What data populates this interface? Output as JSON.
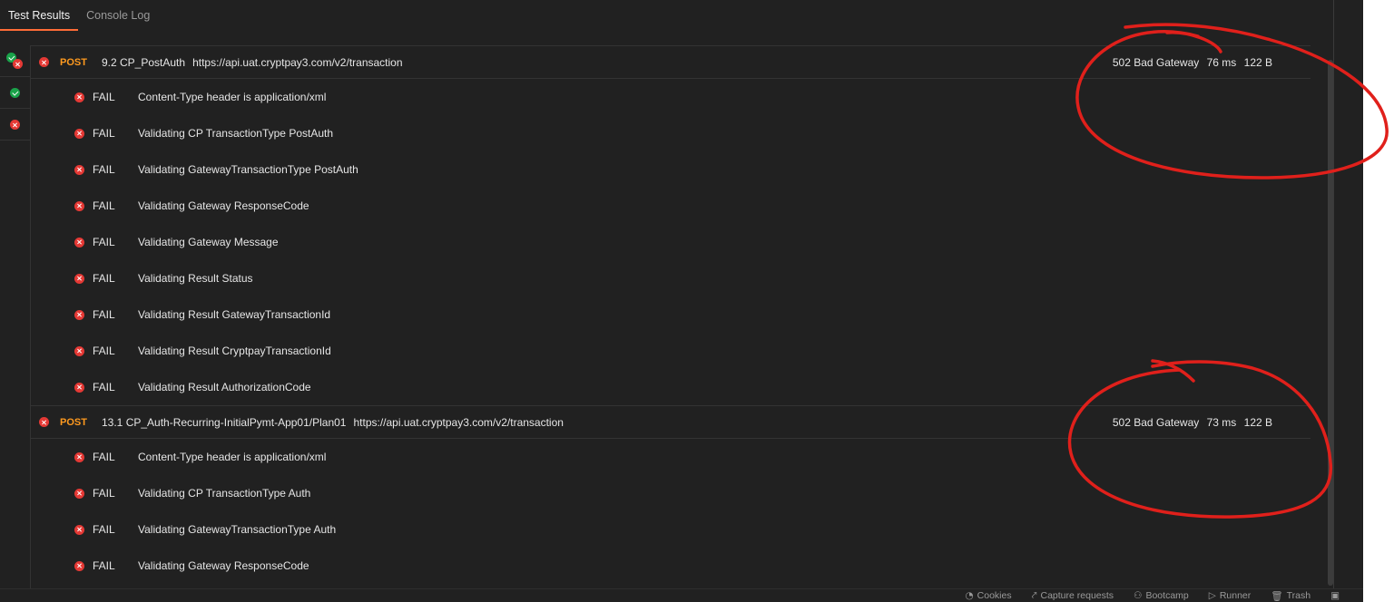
{
  "tabs": [
    {
      "label": "Test Results",
      "active": true
    },
    {
      "label": "Console Log",
      "active": false
    }
  ],
  "rail": [
    "pass-fail",
    "pass",
    "fail"
  ],
  "requests": [
    {
      "method": "POST",
      "name": "9.2 CP_PostAuth",
      "url": "https://api.uat.cryptpay3.com/v2/transaction",
      "status": "502 Bad Gateway",
      "time": "76 ms",
      "size": "122 B",
      "tests": [
        {
          "result": "FAIL",
          "name": "Content-Type header is application/xml"
        },
        {
          "result": "FAIL",
          "name": "Validating CP TransactionType PostAuth"
        },
        {
          "result": "FAIL",
          "name": "Validating GatewayTransactionType PostAuth"
        },
        {
          "result": "FAIL",
          "name": "Validating Gateway ResponseCode"
        },
        {
          "result": "FAIL",
          "name": "Validating Gateway Message"
        },
        {
          "result": "FAIL",
          "name": "Validating Result Status"
        },
        {
          "result": "FAIL",
          "name": "Validating Result GatewayTransactionId"
        },
        {
          "result": "FAIL",
          "name": "Validating Result CryptpayTransactionId"
        },
        {
          "result": "FAIL",
          "name": "Validating Result AuthorizationCode"
        }
      ]
    },
    {
      "method": "POST",
      "name": "13.1 CP_Auth-Recurring-InitialPymt-App01/Plan01",
      "url": "https://api.uat.cryptpay3.com/v2/transaction",
      "status": "502 Bad Gateway",
      "time": "73 ms",
      "size": "122 B",
      "tests": [
        {
          "result": "FAIL",
          "name": "Content-Type header is application/xml"
        },
        {
          "result": "FAIL",
          "name": "Validating CP TransactionType Auth"
        },
        {
          "result": "FAIL",
          "name": "Validating GatewayTransactionType Auth"
        },
        {
          "result": "FAIL",
          "name": "Validating Gateway ResponseCode"
        }
      ]
    }
  ],
  "status_bar": [
    {
      "label": "Cookies",
      "icon": "cookie-icon",
      "glyph": "◔"
    },
    {
      "label": "Capture requests",
      "icon": "capture-icon",
      "glyph": "⤤"
    },
    {
      "label": "Bootcamp",
      "icon": "bootcamp-icon",
      "glyph": "⚇"
    },
    {
      "label": "Runner",
      "icon": "runner-icon",
      "glyph": "▷"
    },
    {
      "label": "Trash",
      "icon": "trash-icon",
      "glyph": "🗑"
    },
    {
      "label": "",
      "icon": "layout-icon",
      "glyph": "▣"
    }
  ],
  "colors": {
    "background": "#212121",
    "accent": "#ff6c37",
    "method": "#ff9a1f",
    "fail": "#e53935",
    "pass": "#1aa34a",
    "annotation": "#e0201b"
  }
}
